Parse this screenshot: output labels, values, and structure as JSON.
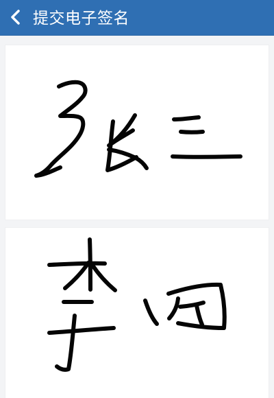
{
  "header": {
    "title": "提交电子签名",
    "back_icon": "chevron-left-icon"
  },
  "signatures": [
    {
      "name": "张三"
    },
    {
      "name": "李四"
    }
  ],
  "colors": {
    "header_background": "#2f6fb3",
    "header_text": "#ffffff",
    "page_background": "#f3f4f6",
    "panel_background": "#ffffff",
    "signature_ink": "#050505"
  }
}
